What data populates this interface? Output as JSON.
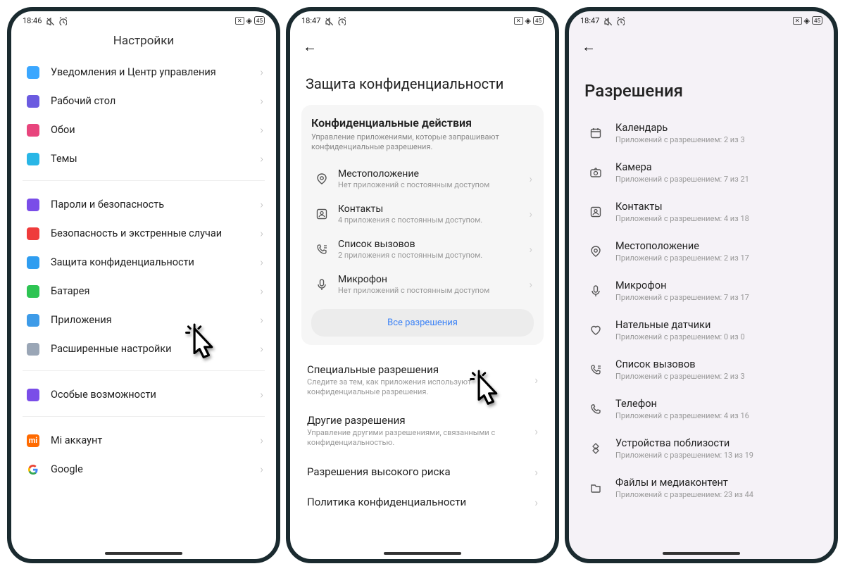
{
  "status": {
    "time1": "18:46",
    "time2": "18:47",
    "time3": "18:47",
    "battery": "45"
  },
  "screen1": {
    "title": "Настройки",
    "group1": [
      {
        "label": "Уведомления и Центр управления",
        "icon": "#3ba7ff"
      },
      {
        "label": "Рабочий стол",
        "icon": "#6b5be0"
      },
      {
        "label": "Обои",
        "icon": "#e8457d"
      },
      {
        "label": "Темы",
        "icon": "#29b6e6"
      }
    ],
    "group2": [
      {
        "label": "Пароли и безопасность",
        "icon": "#7a4de8"
      },
      {
        "label": "Безопасность и экстренные случаи",
        "icon": "#ef3b3b"
      },
      {
        "label": "Защита конфиденциальности",
        "icon": "#2f9df0"
      },
      {
        "label": "Батарея",
        "icon": "#2ec453"
      },
      {
        "label": "Приложения",
        "icon": "#3d9be8"
      },
      {
        "label": "Расширенные настройки",
        "icon": "#9aa6b6"
      }
    ],
    "group3": [
      {
        "label": "Особые возможности",
        "icon": "#7a4de8"
      }
    ],
    "group4": [
      {
        "label": "Mi аккаунт",
        "icon": "#ff6a00"
      },
      {
        "label": "Google",
        "icon": "#ffffff"
      }
    ]
  },
  "screen2": {
    "title": "Защита конфиденциальности",
    "card_title": "Конфиденциальные действия",
    "card_sub": "Управление приложениями, которые запрашивают конфиденциальные разрешения.",
    "items": [
      {
        "t1": "Местоположение",
        "t2": "Нет приложений с постоянным доступом",
        "icon": "location"
      },
      {
        "t1": "Контакты",
        "t2": "4 приложения с постоянным доступом.",
        "icon": "contacts"
      },
      {
        "t1": "Список вызовов",
        "t2": "2 приложения с постоянным доступом.",
        "icon": "calllist"
      },
      {
        "t1": "Микрофон",
        "t2": "Нет приложений с постоянным доступом",
        "icon": "mic"
      }
    ],
    "all_btn": "Все разрешения",
    "sections": [
      {
        "t1": "Специальные разрешения",
        "t2": "Следите за тем, как приложения используют конфиденциальные разрешения."
      },
      {
        "t1": "Другие разрешения",
        "t2": "Управление другими разрешениями, связанными с конфиденциальностью."
      },
      {
        "t1": "Разрешения высокого риска",
        "t2": ""
      },
      {
        "t1": "Политика конфиденциальности",
        "t2": ""
      }
    ]
  },
  "screen3": {
    "title": "Разрешения",
    "items": [
      {
        "t1": "Календарь",
        "t2": "Приложений с разрешением: 2 из 3",
        "icon": "calendar"
      },
      {
        "t1": "Камера",
        "t2": "Приложений с разрешением: 7 из 21",
        "icon": "camera"
      },
      {
        "t1": "Контакты",
        "t2": "Приложений с разрешением: 4 из 18",
        "icon": "contacts"
      },
      {
        "t1": "Местоположение",
        "t2": "Приложений с разрешением: 2 из 17",
        "icon": "location"
      },
      {
        "t1": "Микрофон",
        "t2": "Приложений с разрешением: 7 из 17",
        "icon": "mic"
      },
      {
        "t1": "Нательные датчики",
        "t2": "Приложений с разрешением: 0 из 0",
        "icon": "heart"
      },
      {
        "t1": "Список вызовов",
        "t2": "Приложений с разрешением: 2 из 3",
        "icon": "calllist"
      },
      {
        "t1": "Телефон",
        "t2": "Приложений с разрешением: 4 из 16",
        "icon": "phone"
      },
      {
        "t1": "Устройства поблизости",
        "t2": "Приложений с разрешением: 13 из 19",
        "icon": "nearby"
      },
      {
        "t1": "Файлы и медиаконтент",
        "t2": "Приложений с разрешением: 23 из 44",
        "icon": "files"
      }
    ]
  }
}
